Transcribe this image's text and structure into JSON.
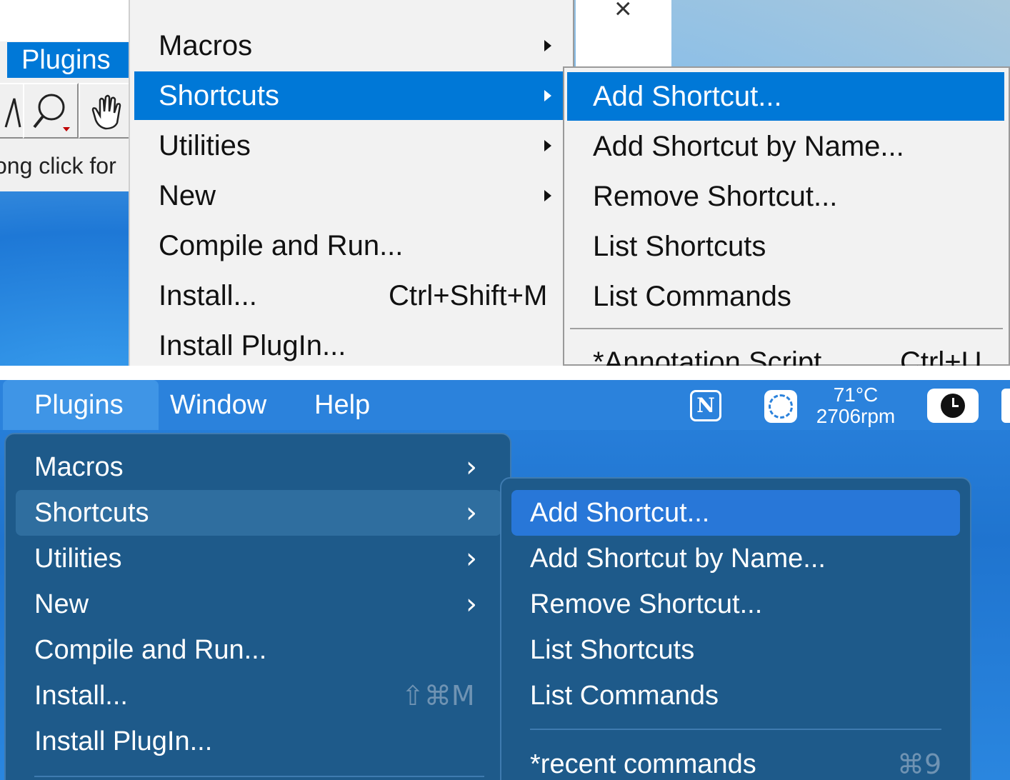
{
  "windows": {
    "menubar_plugins_label": "Plugins",
    "status_text": "ong click for",
    "close_glyph": "×",
    "menu": [
      {
        "label": "Macros",
        "submenu": true
      },
      {
        "label": "Shortcuts",
        "submenu": true,
        "selected": true
      },
      {
        "label": "Utilities",
        "submenu": true
      },
      {
        "label": "New",
        "submenu": true
      },
      {
        "label": "Compile and Run..."
      },
      {
        "label": "Install...",
        "shortcut": "Ctrl+Shift+M"
      },
      {
        "label": "Install PlugIn..."
      }
    ],
    "submenu": [
      {
        "label": "Add Shortcut...",
        "selected": true
      },
      {
        "label": "Add Shortcut by Name..."
      },
      {
        "label": "Remove Shortcut..."
      },
      {
        "label": "List Shortcuts"
      },
      {
        "label": "List Commands"
      },
      {
        "label": "*Annotation Script",
        "shortcut": "Ctrl+U"
      }
    ]
  },
  "mac": {
    "menubar": {
      "items": [
        "Plugins",
        "Window",
        "Help"
      ],
      "notion_glyph": "N",
      "temperature": "71°C",
      "fan_speed": "2706rpm"
    },
    "menu": [
      {
        "label": "Macros",
        "chevron": "›"
      },
      {
        "label": "Shortcuts",
        "chevron": "›",
        "selected": true
      },
      {
        "label": "Utilities",
        "chevron": "›"
      },
      {
        "label": "New",
        "chevron": "›"
      },
      {
        "label": "Compile and Run..."
      },
      {
        "label": "Install...",
        "shortcut": "⇧⌘M"
      },
      {
        "label": "Install PlugIn..."
      }
    ],
    "submenu": [
      {
        "label": "Add Shortcut...",
        "selected": true
      },
      {
        "label": "Add Shortcut by Name..."
      },
      {
        "label": "Remove Shortcut..."
      },
      {
        "label": "List Shortcuts"
      },
      {
        "label": "List Commands"
      },
      {
        "label": "*recent commands",
        "shortcut": "⌘9"
      }
    ]
  }
}
